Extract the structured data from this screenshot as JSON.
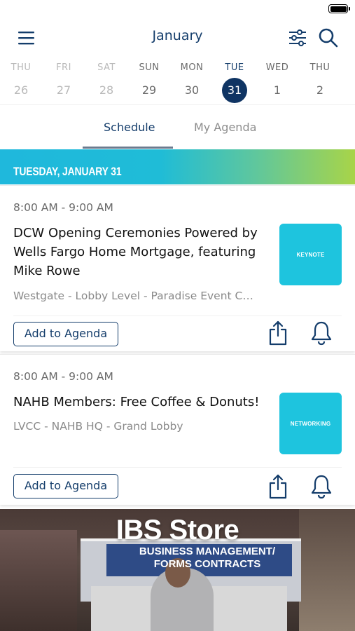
{
  "header": {
    "month": "January"
  },
  "week": [
    {
      "name": "THU",
      "num": "26",
      "state": "past"
    },
    {
      "name": "FRI",
      "num": "27",
      "state": "past"
    },
    {
      "name": "SAT",
      "num": "28",
      "state": "past"
    },
    {
      "name": "SUN",
      "num": "29",
      "state": "current"
    },
    {
      "name": "MON",
      "num": "30",
      "state": "current"
    },
    {
      "name": "TUE",
      "num": "31",
      "state": "selected"
    },
    {
      "name": "WED",
      "num": "1",
      "state": "current"
    },
    {
      "name": "THU",
      "num": "2",
      "state": "current"
    }
  ],
  "tabs": {
    "schedule": "Schedule",
    "my_agenda": "My Agenda",
    "active": "Schedule"
  },
  "date_banner": "TUESDAY, JANUARY 31",
  "sessions": [
    {
      "time": "8:00 AM - 9:00 AM",
      "title": "DCW Opening Ceremonies Powered by Wells Fargo Home Mortgage, featuring Mike Rowe",
      "location": "Westgate - Lobby Level - Paradise Event Ce...",
      "tag": "KEYNOTE",
      "action": "Add to Agenda"
    },
    {
      "time": "8:00 AM - 9:00 AM",
      "title": "NAHB Members: Free Coffee & Donuts!",
      "location": "LVCC - NAHB HQ - Grand Lobby",
      "tag": "NETWORKING",
      "action": "Add to Agenda"
    }
  ],
  "promo": {
    "title": "IBS Store",
    "subtitle": "BUSINESS MANAGEMENT/ FORMS CONTRACTS"
  },
  "icons": {
    "menu": "hamburger-menu-icon",
    "filter": "sliders-filter-icon",
    "search": "search-icon",
    "share": "share-icon",
    "bell": "bell-icon"
  },
  "colors": {
    "primary": "#143d6b",
    "selected_day": "#0f3463",
    "tag": "#1ec4de",
    "banner_start": "#1fb8dc",
    "banner_end": "#a8d448"
  }
}
